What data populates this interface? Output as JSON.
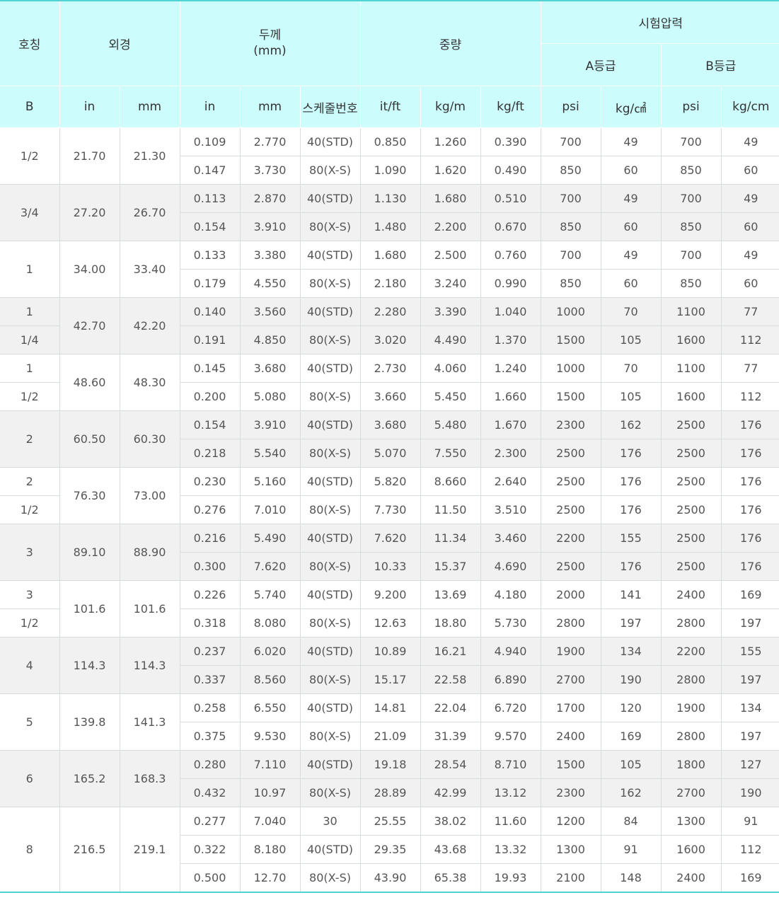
{
  "headers": {
    "nominal": "호칭",
    "outer_diameter": "외경",
    "thickness": "두께\n(mm)",
    "weight": "중량",
    "test_pressure": "시험압력",
    "grade_a": "A등급",
    "grade_b": "B등급",
    "units": [
      "B",
      "in",
      "mm",
      "in",
      "mm",
      "스케줄번호",
      "it/ft",
      "kg/m",
      "kg/ft",
      "psi",
      "kg/㎠",
      "psi",
      "kg/cm"
    ]
  },
  "groups": [
    {
      "b": [
        "1/2"
      ],
      "od_in": "21.70",
      "od_mm": "21.30",
      "rows": [
        [
          "0.109",
          "2.770",
          "40(STD)",
          "0.850",
          "1.260",
          "0.390",
          "700",
          "49",
          "700",
          "49"
        ],
        [
          "0.147",
          "3.730",
          "80(X-S)",
          "1.090",
          "1.620",
          "0.490",
          "850",
          "60",
          "850",
          "60"
        ]
      ]
    },
    {
      "b": [
        "3/4"
      ],
      "od_in": "27.20",
      "od_mm": "26.70",
      "rows": [
        [
          "0.113",
          "2.870",
          "40(STD)",
          "1.130",
          "1.680",
          "0.510",
          "700",
          "49",
          "700",
          "49"
        ],
        [
          "0.154",
          "3.910",
          "80(X-S)",
          "1.480",
          "2.200",
          "0.670",
          "850",
          "60",
          "850",
          "60"
        ]
      ]
    },
    {
      "b": [
        "1"
      ],
      "od_in": "34.00",
      "od_mm": "33.40",
      "rows": [
        [
          "0.133",
          "3.380",
          "40(STD)",
          "1.680",
          "2.500",
          "0.760",
          "700",
          "49",
          "700",
          "49"
        ],
        [
          "0.179",
          "4.550",
          "80(X-S)",
          "2.180",
          "3.240",
          "0.990",
          "850",
          "60",
          "850",
          "60"
        ]
      ]
    },
    {
      "b": [
        "1",
        "1/4"
      ],
      "od_in": "42.70",
      "od_mm": "42.20",
      "rows": [
        [
          "0.140",
          "3.560",
          "40(STD)",
          "2.280",
          "3.390",
          "1.040",
          "1000",
          "70",
          "1100",
          "77"
        ],
        [
          "0.191",
          "4.850",
          "80(X-S)",
          "3.020",
          "4.490",
          "1.370",
          "1500",
          "105",
          "1600",
          "112"
        ]
      ]
    },
    {
      "b": [
        "1",
        "1/2"
      ],
      "od_in": "48.60",
      "od_mm": "48.30",
      "rows": [
        [
          "0.145",
          "3.680",
          "40(STD)",
          "2.730",
          "4.060",
          "1.240",
          "1000",
          "70",
          "1100",
          "77"
        ],
        [
          "0.200",
          "5.080",
          "80(X-S)",
          "3.660",
          "5.450",
          "1.660",
          "1500",
          "105",
          "1600",
          "112"
        ]
      ]
    },
    {
      "b": [
        "2"
      ],
      "od_in": "60.50",
      "od_mm": "60.30",
      "rows": [
        [
          "0.154",
          "3.910",
          "40(STD)",
          "3.680",
          "5.480",
          "1.670",
          "2300",
          "162",
          "2500",
          "176"
        ],
        [
          "0.218",
          "5.540",
          "80(X-S)",
          "5.070",
          "7.550",
          "2.300",
          "2500",
          "176",
          "2500",
          "176"
        ]
      ]
    },
    {
      "b": [
        "2",
        "1/2"
      ],
      "od_in": "76.30",
      "od_mm": "73.00",
      "rows": [
        [
          "0.230",
          "5.160",
          "40(STD)",
          "5.820",
          "8.660",
          "2.640",
          "2500",
          "176",
          "2500",
          "176"
        ],
        [
          "0.276",
          "7.010",
          "80(X-S)",
          "7.730",
          "11.50",
          "3.510",
          "2500",
          "176",
          "2500",
          "176"
        ]
      ]
    },
    {
      "b": [
        "3"
      ],
      "od_in": "89.10",
      "od_mm": "88.90",
      "rows": [
        [
          "0.216",
          "5.490",
          "40(STD)",
          "7.620",
          "11.34",
          "3.460",
          "2200",
          "155",
          "2500",
          "176"
        ],
        [
          "0.300",
          "7.620",
          "80(X-S)",
          "10.33",
          "15.37",
          "4.690",
          "2500",
          "176",
          "2500",
          "176"
        ]
      ]
    },
    {
      "b": [
        "3",
        "1/2"
      ],
      "od_in": "101.6",
      "od_mm": "101.6",
      "rows": [
        [
          "0.226",
          "5.740",
          "40(STD)",
          "9.200",
          "13.69",
          "4.180",
          "2000",
          "141",
          "2400",
          "169"
        ],
        [
          "0.318",
          "8.080",
          "80(X-S)",
          "12.63",
          "18.80",
          "5.730",
          "2800",
          "197",
          "2800",
          "197"
        ]
      ]
    },
    {
      "b": [
        "4"
      ],
      "od_in": "114.3",
      "od_mm": "114.3",
      "rows": [
        [
          "0.237",
          "6.020",
          "40(STD)",
          "10.89",
          "16.21",
          "4.940",
          "1900",
          "134",
          "2200",
          "155"
        ],
        [
          "0.337",
          "8.560",
          "80(X-S)",
          "15.17",
          "22.58",
          "6.890",
          "2700",
          "190",
          "2800",
          "197"
        ]
      ]
    },
    {
      "b": [
        "5"
      ],
      "od_in": "139.8",
      "od_mm": "141.3",
      "rows": [
        [
          "0.258",
          "6.550",
          "40(STD)",
          "14.81",
          "22.04",
          "6.720",
          "1700",
          "120",
          "1900",
          "134"
        ],
        [
          "0.375",
          "9.530",
          "80(X-S)",
          "21.09",
          "31.39",
          "9.570",
          "2400",
          "169",
          "2800",
          "197"
        ]
      ]
    },
    {
      "b": [
        "6"
      ],
      "od_in": "165.2",
      "od_mm": "168.3",
      "rows": [
        [
          "0.280",
          "7.110",
          "40(STD)",
          "19.18",
          "28.54",
          "8.710",
          "1500",
          "105",
          "1800",
          "127"
        ],
        [
          "0.432",
          "10.97",
          "80(X-S)",
          "28.89",
          "42.99",
          "13.12",
          "2300",
          "162",
          "2700",
          "190"
        ]
      ]
    },
    {
      "b": [
        "8"
      ],
      "od_in": "216.5",
      "od_mm": "219.1",
      "rows": [
        [
          "0.277",
          "7.040",
          "30",
          "25.55",
          "38.02",
          "11.60",
          "1200",
          "84",
          "1300",
          "91"
        ],
        [
          "0.322",
          "8.180",
          "40(STD)",
          "29.35",
          "43.68",
          "13.32",
          "1300",
          "91",
          "1600",
          "112"
        ],
        [
          "0.500",
          "12.70",
          "80(X-S)",
          "43.90",
          "65.38",
          "19.93",
          "2100",
          "148",
          "2400",
          "169"
        ]
      ]
    }
  ]
}
